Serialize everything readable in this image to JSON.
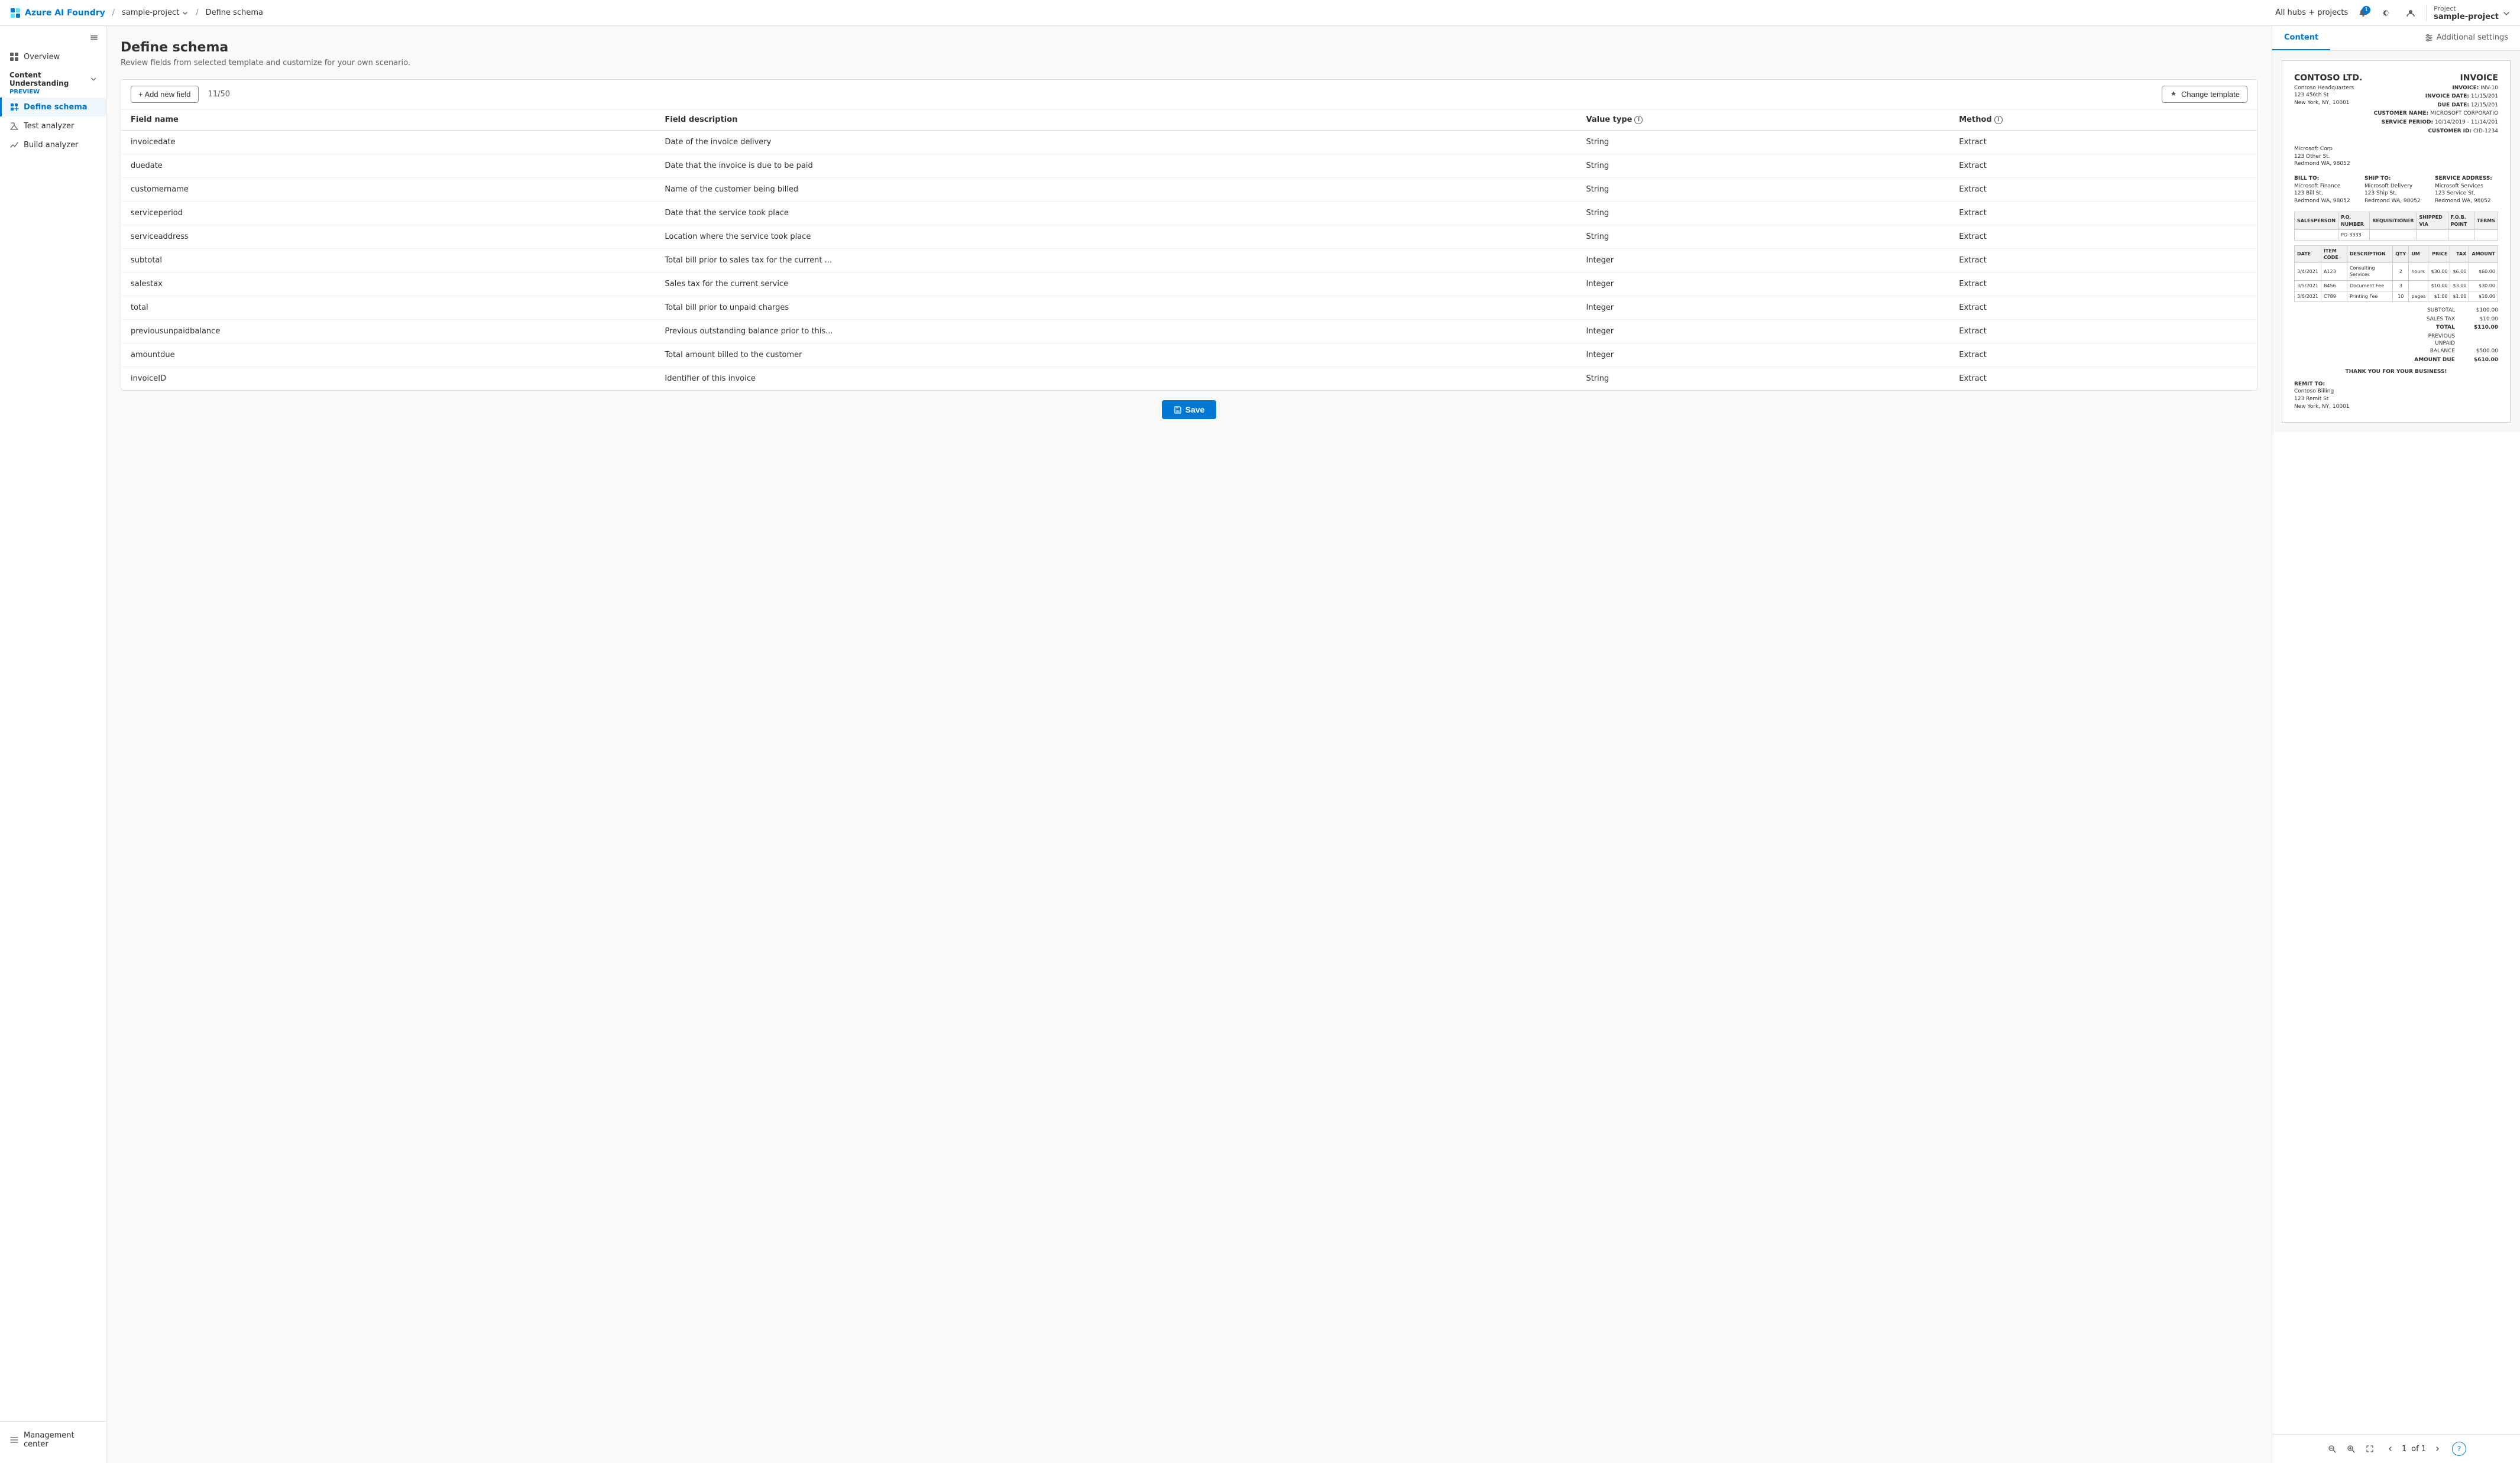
{
  "topnav": {
    "app_name": "Azure AI Foundry",
    "project_name": "sample-project",
    "page_name": "Define schema",
    "hubs_label": "All hubs + projects",
    "notif_count": "1",
    "project_label": "Project",
    "project_display": "sample-project"
  },
  "sidebar": {
    "toggle_label": "Toggle sidebar",
    "overview_label": "Overview",
    "section_label": "Content Understanding",
    "section_badge": "PREVIEW",
    "define_schema_label": "Define schema",
    "test_analyzer_label": "Test analyzer",
    "build_analyzer_label": "Build analyzer",
    "management_label": "Management center"
  },
  "main": {
    "title": "Define schema",
    "subtitle": "Review fields from selected template and customize for your own scenario.",
    "add_field_label": "+ Add new field",
    "field_count": "11/50",
    "change_template_label": "Change template",
    "table": {
      "headers": [
        "Field name",
        "Field description",
        "Value type",
        "Method"
      ],
      "rows": [
        {
          "name": "invoicedate",
          "description": "Date of the invoice delivery",
          "type": "String",
          "method": "Extract"
        },
        {
          "name": "duedate",
          "description": "Date that the invoice is due to be paid",
          "type": "String",
          "method": "Extract"
        },
        {
          "name": "customername",
          "description": "Name of the customer being billed",
          "type": "String",
          "method": "Extract"
        },
        {
          "name": "serviceperiod",
          "description": "Date that the service took place",
          "type": "String",
          "method": "Extract"
        },
        {
          "name": "serviceaddress",
          "description": "Location where the service took place",
          "type": "String",
          "method": "Extract"
        },
        {
          "name": "subtotal",
          "description": "Total bill prior to sales tax for the current ...",
          "type": "Integer",
          "method": "Extract"
        },
        {
          "name": "salestax",
          "description": "Sales tax for the current service",
          "type": "Integer",
          "method": "Extract"
        },
        {
          "name": "total",
          "description": "Total bill prior to unpaid charges",
          "type": "Integer",
          "method": "Extract"
        },
        {
          "name": "previousunpaidbalance",
          "description": "Previous outstanding balance prior to this...",
          "type": "Integer",
          "method": "Extract"
        },
        {
          "name": "amountdue",
          "description": "Total amount billed to the customer",
          "type": "Integer",
          "method": "Extract"
        },
        {
          "name": "invoiceID",
          "description": "Identifier of this invoice",
          "type": "String",
          "method": "Extract"
        }
      ]
    },
    "save_label": "Save"
  },
  "right_panel": {
    "content_tab": "Content",
    "settings_tab": "Additional settings",
    "invoice": {
      "company": "CONTOSO LTD.",
      "title": "INVOICE",
      "address_line1": "Contoso Headquarters",
      "address_line2": "123 456th St",
      "address_line3": "New York, NY, 10001",
      "inv_label": "INVOICE:",
      "inv_number": "INV-10",
      "inv_date_label": "INVOICE DATE:",
      "inv_date": "11/15/201",
      "due_date_label": "DUE DATE:",
      "due_date": "12/15/201",
      "customer_label": "CUSTOMER NAME:",
      "customer": "MICROSOFT CORPORATIO",
      "service_period_label": "SERVICE PERIOD:",
      "service_period": "10/14/2019 - 11/14/201",
      "customer_id_label": "CUSTOMER ID:",
      "customer_id": "CID-1234",
      "client_name": "Microsoft Corp",
      "client_addr1": "123 Other St.",
      "client_addr2": "Redmond WA, 98052",
      "bill_to_label": "BILL TO:",
      "bill_to_name": "Microsoft Finance",
      "bill_to_addr1": "123 Bill St,",
      "bill_to_addr2": "Redmond WA, 98052",
      "ship_to_label": "SHIP TO:",
      "ship_to_name": "Microsoft Delivery",
      "ship_to_addr1": "123 Ship St,",
      "ship_to_addr2": "Redmond WA, 98052",
      "service_addr_label": "SERVICE ADDRESS:",
      "service_addr_name": "Microsoft Services",
      "service_addr1": "123 Service St,",
      "service_addr2": "Redmond WA, 98052",
      "col_salesperson": "SALESPERSON",
      "col_po": "P.O. NUMBER",
      "col_req": "REQUISITIONER",
      "col_shipped": "SHIPPED VIA",
      "col_fob": "F.O.B. POINT",
      "col_terms": "TERMS",
      "po_number": "PO-3333",
      "col_date": "DATE",
      "col_item": "ITEM CODE",
      "col_desc": "DESCRIPTION",
      "col_qty": "QTY",
      "col_um": "UM",
      "col_price": "PRICE",
      "col_tax": "TAX",
      "col_amount": "AMOUNT",
      "line_items": [
        {
          "date": "3/4/2021",
          "code": "A123",
          "desc": "Consulting Services",
          "qty": "2",
          "um": "hours",
          "price": "$30.00",
          "tax": "$6.00",
          "amount": "$60.00"
        },
        {
          "date": "3/5/2021",
          "code": "B456",
          "desc": "Document Fee",
          "qty": "3",
          "um": "",
          "price": "$10.00",
          "tax": "$3.00",
          "amount": "$30.00"
        },
        {
          "date": "3/6/2021",
          "code": "C789",
          "desc": "Printing Fee",
          "qty": "10",
          "um": "pages",
          "price": "$1.00",
          "tax": "$1.00",
          "amount": "$10.00"
        }
      ],
      "subtotal_label": "SUBTOTAL",
      "subtotal_value": "$100.00",
      "salestax_label": "SALES TAX",
      "salestax_value": "$10.00",
      "total_label": "TOTAL",
      "total_value": "$110.00",
      "prev_balance_label": "PREVIOUS UNPAID BALANCE",
      "prev_balance_value": "$500.00",
      "amount_due_label": "AMOUNT DUE",
      "amount_due_value": "$610.00",
      "thankyou": "THANK YOU FOR YOUR BUSINESS!",
      "remit_label": "REMIT TO:",
      "remit_name": "Contoso Billing",
      "remit_addr1": "123 Remit St",
      "remit_addr2": "New York, NY, 10001"
    },
    "page_current": "1",
    "page_of": "of 1"
  }
}
